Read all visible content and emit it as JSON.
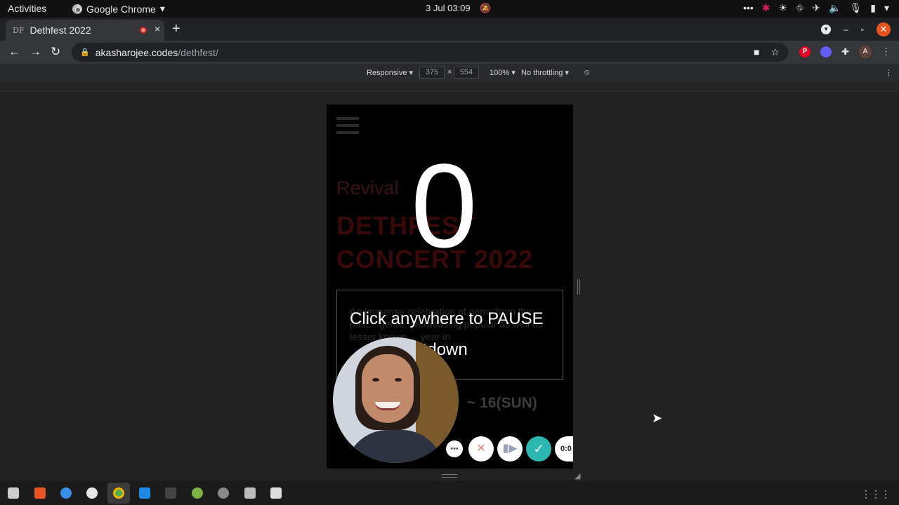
{
  "topbar": {
    "activities": "Activities",
    "app_name": "Google Chrome",
    "app_caret": "▾",
    "clock": "3 Jul  03:09",
    "tray_icons": [
      "dots-icon",
      "slack-icon",
      "brightness-icon",
      "network-icon",
      "airplane-icon",
      "volume-icon",
      "mic-icon",
      "battery-icon",
      "power-menu-icon"
    ]
  },
  "tab": {
    "favicon_text": "DF",
    "title": "Dethfest 2022",
    "close": "×",
    "new_tab": "+"
  },
  "window_controls": {
    "minimize": "–",
    "maximize": "▫",
    "close": "✕"
  },
  "toolbar": {
    "back": "←",
    "forward": "→",
    "reload": "↻",
    "url_host": "akasharojee.codes",
    "url_path": "/dethfest/",
    "avatar_letter": "A"
  },
  "devtools": {
    "device": "Responsive ▾",
    "width": "375",
    "times": "×",
    "height": "554",
    "zoom": "100% ▾",
    "throttling": "No throttling ▾"
  },
  "page": {
    "revival": "Revival",
    "title_line1": "DETHFEST",
    "title_line2": "CONCERT 2022",
    "description": "An immense celebration of gems from the past... genre, showcasing popular as well as lesser known ... year in",
    "date": "~ 16(SUN)"
  },
  "overlay": {
    "countdown_number": "0",
    "pause_text": "Click anywhere to PAUSE",
    "countdown_label": "untdown",
    "timer": "0:0"
  },
  "colors": {
    "accent_done": "#2bb8b0",
    "cancel": "#e07c7c",
    "close_window": "#e9541d"
  }
}
